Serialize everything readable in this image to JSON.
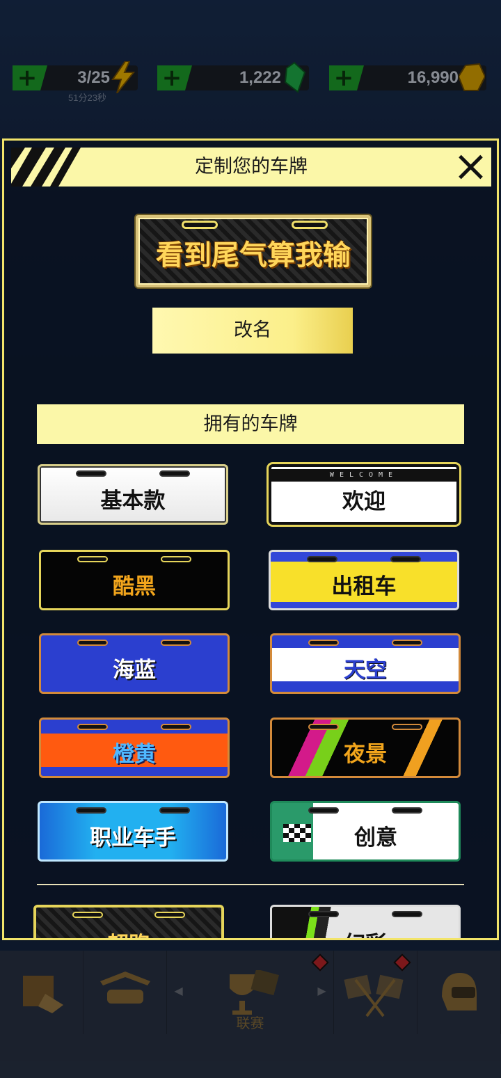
{
  "resources": {
    "energy": {
      "value": "3/25",
      "timer": "51分23秒",
      "icon": "lightning-icon",
      "color": "#f5b800"
    },
    "gems": {
      "value": "1,222",
      "icon": "green-gem-icon",
      "color": "#1fb34a"
    },
    "coins": {
      "value": "16,990",
      "icon": "gold-hexagon-icon",
      "color": "#e0a800"
    }
  },
  "dialog": {
    "title": "定制您的车牌",
    "current_plate_text": "看到尾气算我输",
    "rename_label": "改名",
    "owned_header": "拥有的车牌",
    "plates": [
      {
        "label": "基本款"
      },
      {
        "label": "欢迎",
        "header": "WELCOME"
      },
      {
        "label": "酷黑"
      },
      {
        "label": "出租车"
      },
      {
        "label": "海蓝"
      },
      {
        "label": "天空"
      },
      {
        "label": "橙黄"
      },
      {
        "label": "夜景"
      },
      {
        "label": "职业车手"
      },
      {
        "label": "创意"
      }
    ],
    "partial_plates": [
      {
        "label": "超跑"
      },
      {
        "label": "幻彩"
      }
    ]
  },
  "bottom_nav": {
    "active_label": "联赛",
    "items": [
      "shop-icon",
      "garage-icon",
      "league-icon",
      "race-flags-icon",
      "helmet-icon"
    ]
  },
  "colors": {
    "accent": "#fbf7a8",
    "border": "#f2e46a"
  }
}
